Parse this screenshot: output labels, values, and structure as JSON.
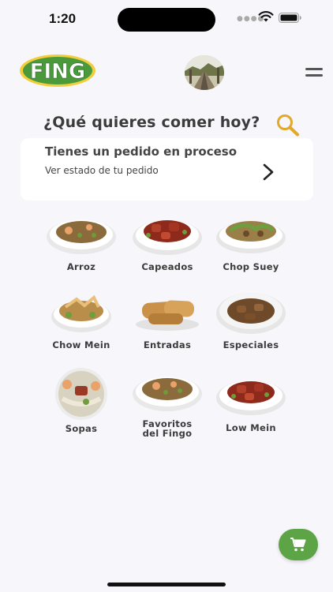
{
  "status_bar": {
    "time": "1:20"
  },
  "header": {
    "logo_text": "FING"
  },
  "search": {
    "prompt": "¿Qué quieres comer hoy?"
  },
  "order": {
    "title": "Tienes un pedido en proceso",
    "subtitle": "Ver estado de tu pedido"
  },
  "categories": [
    {
      "label": "Arroz"
    },
    {
      "label": "Capeados"
    },
    {
      "label": "Chop Suey"
    },
    {
      "label": "Chow Mein"
    },
    {
      "label": "Entradas"
    },
    {
      "label": "Especiales"
    },
    {
      "label": "Sopas"
    },
    {
      "label": "Favoritos\ndel Fingo"
    },
    {
      "label": "Low Mein"
    }
  ],
  "colors": {
    "brand_green": "#5ca446",
    "logo_yellow": "#f2cd3c",
    "search_gold": "#e2a82a",
    "background": "#f7f6fb"
  },
  "icons": [
    "wifi-icon",
    "battery-icon",
    "menu-icon",
    "search-icon",
    "chevron-right-icon",
    "cart-icon"
  ]
}
